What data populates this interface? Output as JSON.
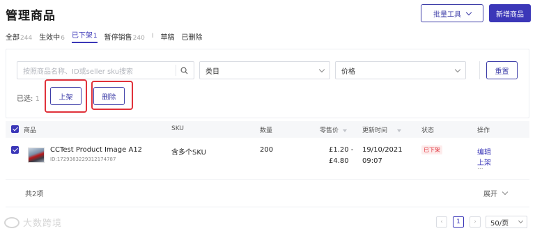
{
  "header": {
    "title": "管理商品",
    "bulk_tools_label": "批量工具",
    "new_product_label": "新增商品"
  },
  "tabs": [
    {
      "label": "全部",
      "count": "244"
    },
    {
      "label": "生效中",
      "count": "6"
    },
    {
      "label": "已下架",
      "count": "1"
    },
    {
      "label": "暂停销售",
      "count": "240"
    },
    {
      "label": "草稿",
      "count": ""
    },
    {
      "label": "已删除",
      "count": ""
    }
  ],
  "tab_separator": "I",
  "filters": {
    "search_placeholder": "按照商品名称、ID或seller sku搜索",
    "category_label": "类目",
    "price_label": "价格",
    "reset_label": "重置"
  },
  "selection": {
    "selected_label": "已选:",
    "selected_count": "1",
    "list_label": "上架",
    "delete_label": "删除"
  },
  "table": {
    "columns": [
      "商品",
      "SKU",
      "数量",
      "零售价",
      "更新时间",
      "状态",
      "操作"
    ],
    "rows": [
      {
        "name": "CCTest Product Image A12",
        "id": "ID:1729383229312174787",
        "sku": "含多个SKU",
        "quantity": "200",
        "price_line1": "£1.20 -",
        "price_line2": "£4.80",
        "updated_line1": "19/10/2021",
        "updated_line2": "09:07",
        "status": "已下架",
        "action_edit": "编辑",
        "action_list": "上架",
        "action_more": "..."
      }
    ]
  },
  "footer": {
    "total_label": "共2项",
    "expand_label": "展开",
    "current_page": "1",
    "page_size_label": "50/页"
  },
  "watermark": "大数跨境",
  "colors": {
    "accent": "#3b37b8",
    "danger": "#e0313a"
  }
}
